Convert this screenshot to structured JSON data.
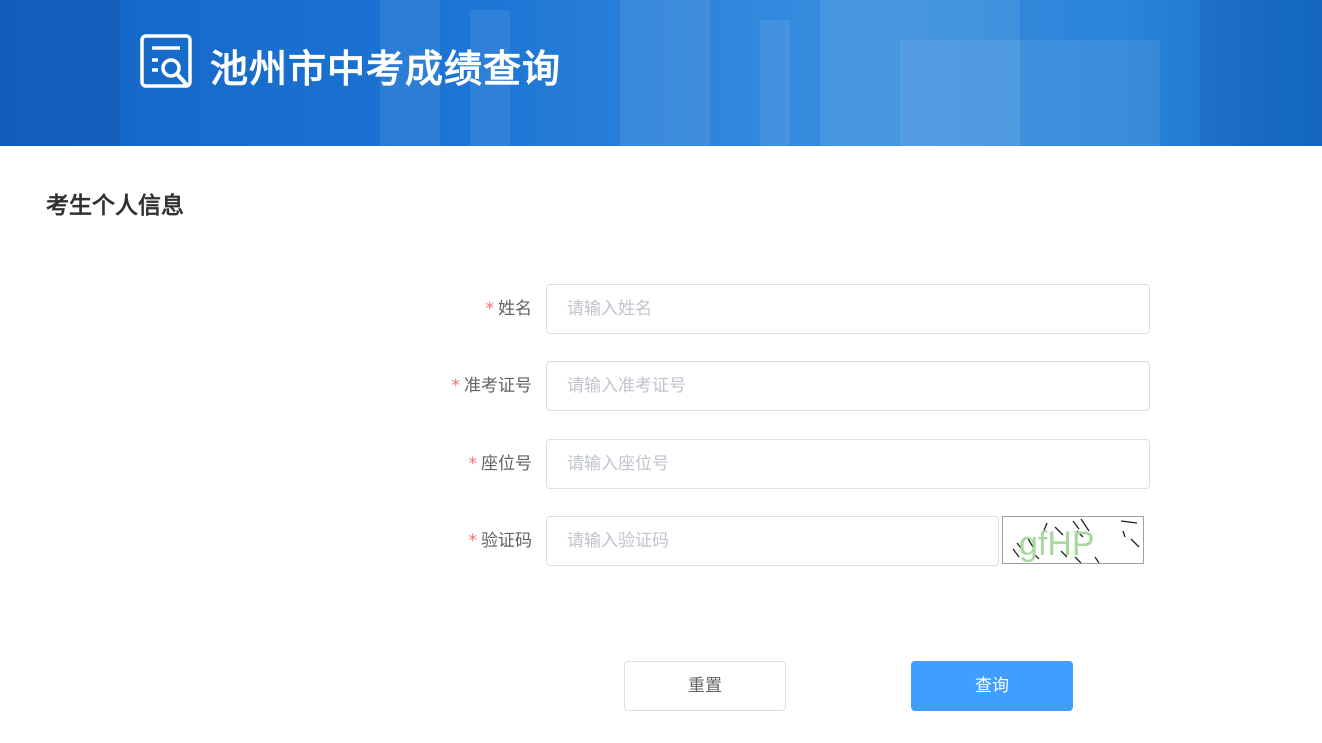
{
  "header": {
    "title": "池州市中考成绩查询",
    "logo_icon": "search-document-icon",
    "background_color": "#1c74d4"
  },
  "section": {
    "title": "考生个人信息"
  },
  "form": {
    "required_mark": "*",
    "name": {
      "label": "姓名",
      "placeholder": "请输入姓名",
      "value": ""
    },
    "exam_number": {
      "label": "准考证号",
      "placeholder": "请输入准考证号",
      "value": ""
    },
    "seat_number": {
      "label": "座位号",
      "placeholder": "请输入座位号",
      "value": ""
    },
    "captcha": {
      "label": "验证码",
      "placeholder": "请输入验证码",
      "value": "",
      "image_text": "gfHP"
    }
  },
  "buttons": {
    "reset": "重置",
    "query": "查询"
  },
  "colors": {
    "primary": "#409eff",
    "required": "#f56c6c",
    "text": "#606266",
    "placeholder": "#c0c4cc"
  }
}
